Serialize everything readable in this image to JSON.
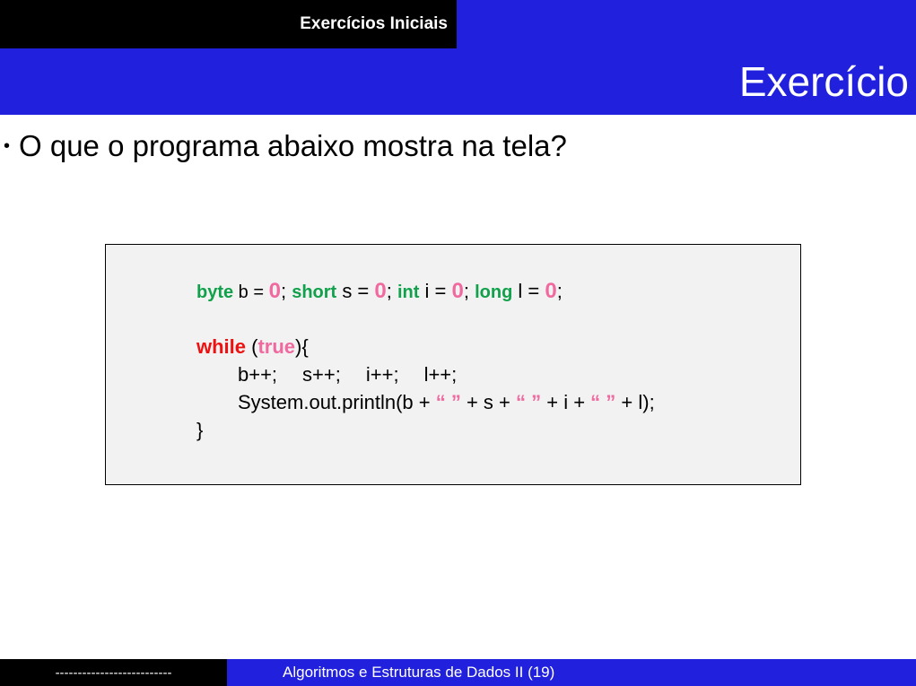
{
  "header": {
    "section_title": "Exercícios Iniciais",
    "slide_title": "Exercício"
  },
  "bullet": {
    "text": "O que o programa abaixo mostra na tela?"
  },
  "code": {
    "line1": {
      "kw_byte": "byte",
      "t1": " b = ",
      "n1": "0",
      "t2": "; ",
      "kw_short": "short",
      "t3": " s = ",
      "n2": "0",
      "t4": "; ",
      "kw_int": "int",
      "t5": " i = ",
      "n3": "0",
      "t6": "; ",
      "kw_long": "long",
      "t7": " l = ",
      "n4": "0",
      "t8": ";"
    },
    "line2": {
      "kw_while": "while",
      "t1": " (",
      "kw_true": "true",
      "t2": "){"
    },
    "line3": {
      "s1": "b++;",
      "s2": "s++;",
      "s3": "i++;",
      "s4": "l++;"
    },
    "line4": {
      "t1": "System.out.println(b + ",
      "q1": "“ ”",
      "t2": " + s + ",
      "q2": "“ ”",
      "t3": " + i + ",
      "q3": "“ ”",
      "t4": " + l);"
    },
    "line5": {
      "t1": "}"
    }
  },
  "footer": {
    "left_text": "--------------------------",
    "right_text": "Algoritmos e Estruturas de Dados II (19)"
  },
  "colors": {
    "blue": "#2121dd",
    "keyword_green": "#11a04b",
    "keyword_red": "#ee1111",
    "literal_pink": "#f06aa0"
  }
}
